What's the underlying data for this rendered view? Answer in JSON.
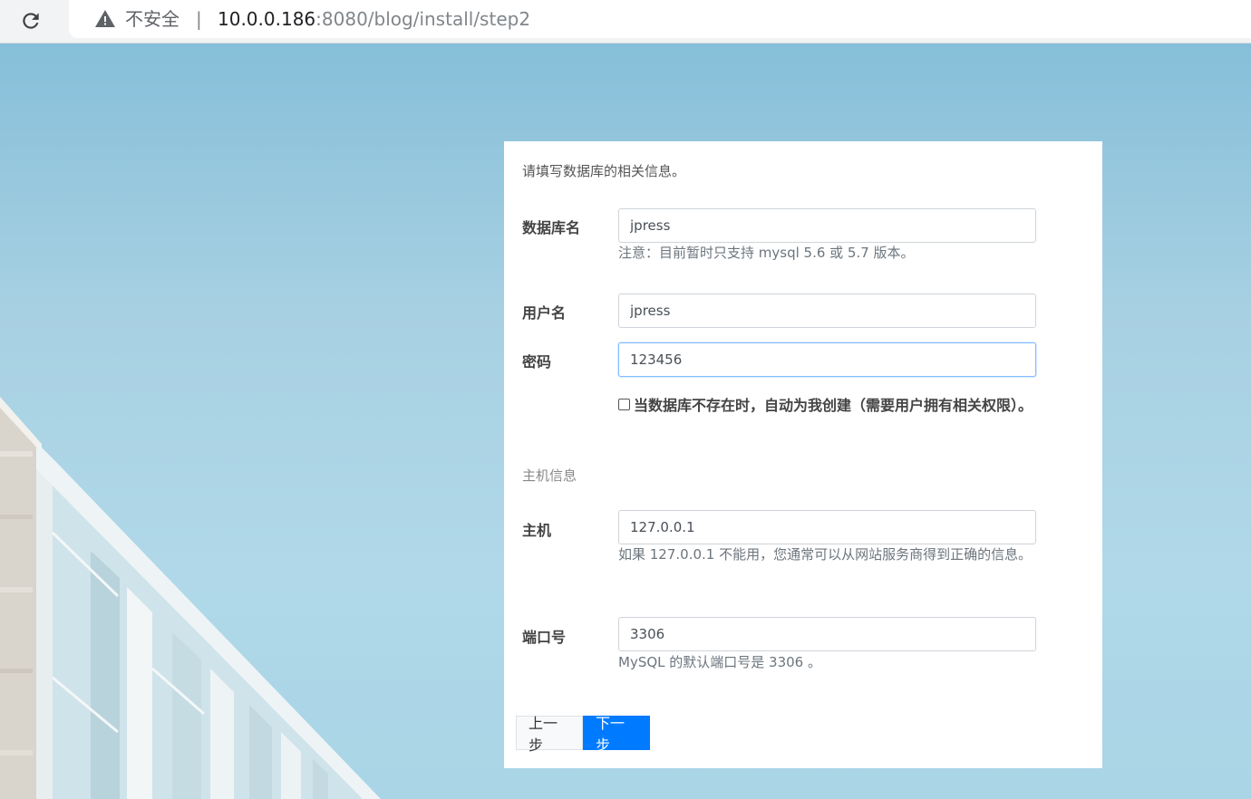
{
  "browser": {
    "insecure_label": "不安全",
    "divider": "|",
    "url_host": "10.0.0.186",
    "url_rest": ":8080/blog/install/step2",
    "icons": {
      "reload": "reload-icon",
      "warning": "warning-icon"
    }
  },
  "form": {
    "intro": "请填写数据库的相关信息。",
    "fields": {
      "db_name": {
        "label": "数据库名",
        "value": "jpress",
        "hint": "注意：目前暂时只支持 mysql 5.6 或 5.7 版本。"
      },
      "username": {
        "label": "用户名",
        "value": "jpress"
      },
      "password": {
        "label": "密码",
        "value": "123456"
      },
      "auto_create": {
        "label": "当数据库不存在时，自动为我创建（需要用户拥有相关权限）。",
        "checked": false
      },
      "host": {
        "label": "主机",
        "value": "127.0.0.1",
        "hint": "如果 127.0.0.1 不能用，您通常可以从网站服务商得到正确的信息。"
      },
      "port": {
        "label": "端口号",
        "value": "3306",
        "hint": "MySQL 的默认端口号是 3306 。"
      }
    },
    "section_host": "主机信息",
    "buttons": {
      "prev": "上一步",
      "next": "下一步"
    },
    "colors": {
      "primary": "#007bff",
      "background_sky": "#a7d0e2"
    }
  }
}
